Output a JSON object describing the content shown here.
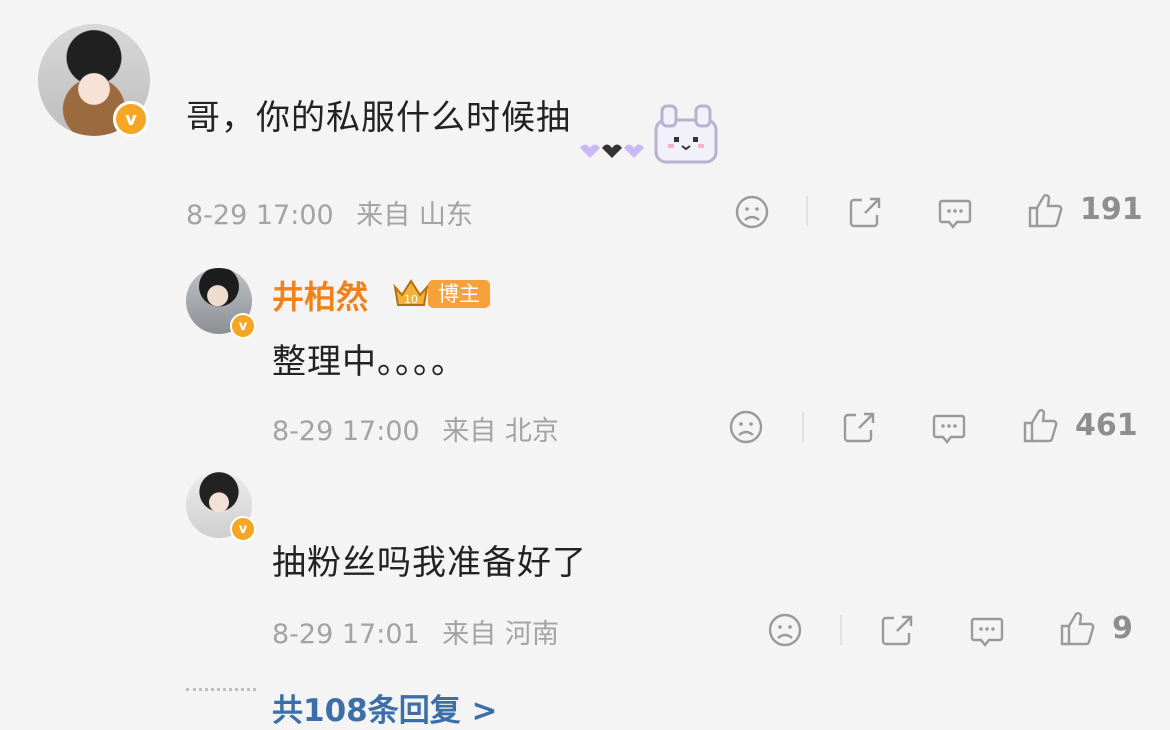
{
  "comments": [
    {
      "text": "哥，你的私服什么时候抽",
      "time": "8-29 17:00",
      "source": "来自 山东",
      "likes": "191",
      "verified_mark": "v",
      "sticker": "rabbit-sticker-icon"
    }
  ],
  "replies": [
    {
      "author": "井柏然",
      "author_badge": "博主",
      "author_level": "10",
      "text": "整理中。。。。",
      "time": "8-29 17:00",
      "source": "来自 北京",
      "likes": "461",
      "verified_mark": "v"
    },
    {
      "text": "抽粉丝吗我准备好了",
      "time": "8-29 17:01",
      "source": "来自 河南",
      "likes": "9",
      "verified_mark": "v"
    }
  ],
  "more_replies_label": "共108条回复 >",
  "colors": {
    "background": "#f4f4f4",
    "author_orange": "#f0821e",
    "badge_orange": "#f7a13a",
    "verified_orange": "#f5a623",
    "link_blue": "#3d6ea8",
    "meta_gray": "#a3a3a3"
  },
  "icons": [
    "sad-face-icon",
    "share-icon",
    "comment-icon",
    "thumbs-up-icon",
    "crown-icon",
    "rabbit-sticker-icon"
  ]
}
